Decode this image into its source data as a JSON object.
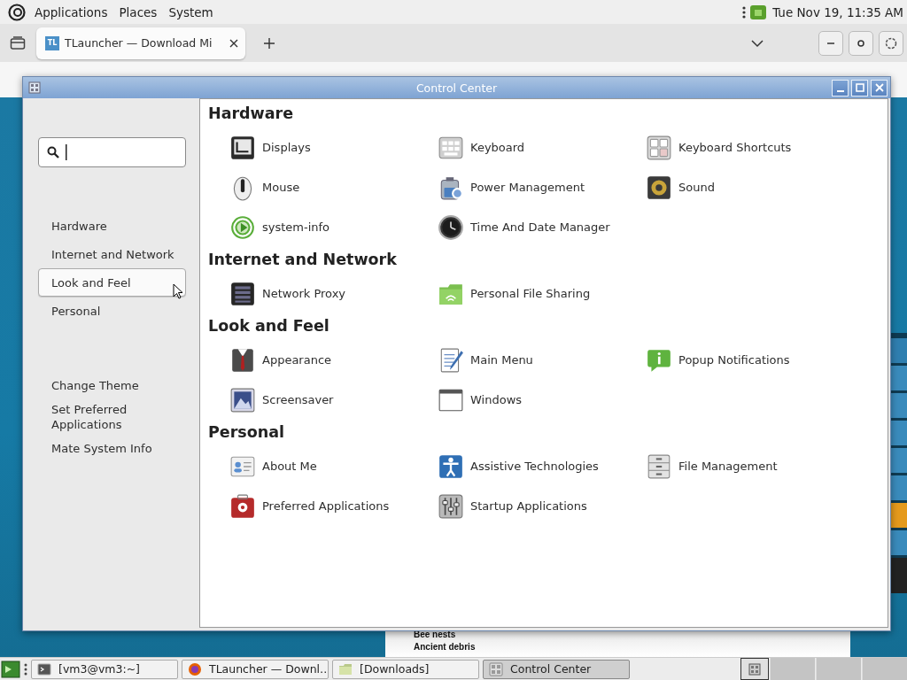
{
  "top_panel": {
    "menus": [
      "Applications",
      "Places",
      "System"
    ],
    "clock": "Tue Nov 19, 11:35 AM"
  },
  "browser": {
    "tabs": [
      {
        "favicon_text": "TL",
        "title": "TLauncher — Download Mi",
        "selected": true
      }
    ],
    "page_texts": [
      "Bee nests",
      "Ancient debris"
    ]
  },
  "window": {
    "title": "Control Center"
  },
  "sidebar": {
    "groups": [
      {
        "label": "Hardware",
        "selected": false
      },
      {
        "label": "Internet and Network",
        "selected": false
      },
      {
        "label": "Look and Feel",
        "selected": true
      },
      {
        "label": "Personal",
        "selected": false
      }
    ],
    "tasks": [
      "Change Theme",
      "Set Preferred Applications",
      "Mate System Info"
    ]
  },
  "sections": [
    {
      "title": "Hardware",
      "items": [
        "Displays",
        "Keyboard",
        "Keyboard Shortcuts",
        "Mouse",
        "Power Management",
        "Sound",
        "system-info",
        "Time And Date Manager"
      ]
    },
    {
      "title": "Internet and Network",
      "items": [
        "Network Proxy",
        "Personal File Sharing"
      ]
    },
    {
      "title": "Look and Feel",
      "items": [
        "Appearance",
        "Main Menu",
        "Popup Notifications",
        "Screensaver",
        "Windows"
      ]
    },
    {
      "title": "Personal",
      "items": [
        "About Me",
        "Assistive Technologies",
        "File Management",
        "Preferred Applications",
        "Startup Applications"
      ]
    }
  ],
  "taskbar": {
    "buttons": [
      {
        "label": "[vm3@vm3:~]",
        "selected": false
      },
      {
        "label": "TLauncher — Downl…",
        "selected": false
      },
      {
        "label": "[Downloads]",
        "selected": false
      },
      {
        "label": "Control Center",
        "selected": true
      }
    ],
    "workspaces": [
      {
        "selected": true
      },
      {
        "selected": false
      },
      {
        "selected": false
      },
      {
        "selected": false
      }
    ]
  }
}
